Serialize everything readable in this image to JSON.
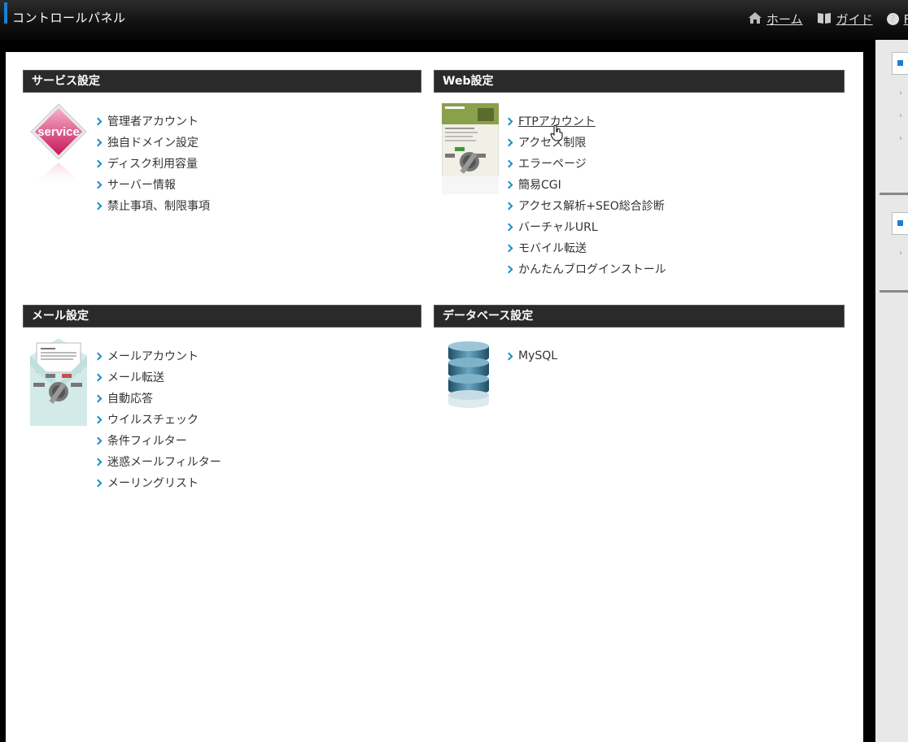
{
  "topbar": {
    "title": "コントロールパネル",
    "nav": [
      {
        "label": "ホーム",
        "icon": "home-icon"
      },
      {
        "label": "ガイド",
        "icon": "book-icon"
      },
      {
        "label": "F",
        "icon": "help-icon"
      }
    ]
  },
  "sections": {
    "service": {
      "title": "サービス設定",
      "thumb_text": "service",
      "items": [
        "管理者アカウント",
        "独自ドメイン設定",
        "ディスク利用容量",
        "サーバー情報",
        "禁止事項、制限事項"
      ]
    },
    "web": {
      "title": "Web設定",
      "items": [
        "FTPアカウント",
        "アクセス制限",
        "エラーページ",
        "簡易CGI",
        "アクセス解析+SEO総合診断",
        "バーチャルURL",
        "モバイル転送",
        "かんたんブログインストール"
      ]
    },
    "mail": {
      "title": "メール設定",
      "items": [
        "メールアカウント",
        "メール転送",
        "自動応答",
        "ウイルスチェック",
        "条件フィルター",
        "迷惑メールフィルター",
        "メーリングリスト"
      ]
    },
    "database": {
      "title": "データベース設定",
      "items": [
        "MySQL"
      ]
    }
  },
  "colors": {
    "accent": "#1a7fd6",
    "chevron": "#1a8fc6",
    "header_bg": "#2a2a2a"
  }
}
